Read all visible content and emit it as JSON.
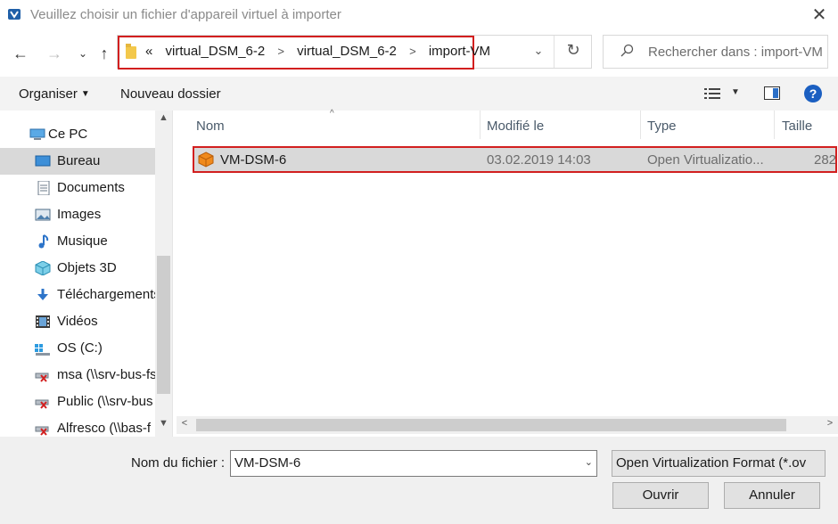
{
  "window": {
    "title": "Veuillez choisir un fichier d'appareil virtuel à importer"
  },
  "address": {
    "overflow": "«",
    "crumbs": [
      "virtual_DSM_6-2",
      "virtual_DSM_6-2",
      "import-VM"
    ]
  },
  "search": {
    "placeholder": "Rechercher dans : import-VM"
  },
  "toolbar": {
    "organize": "Organiser",
    "new_folder": "Nouveau dossier"
  },
  "sidebar": {
    "items": [
      {
        "label": "Ce PC",
        "icon": "computer-icon"
      },
      {
        "label": "Bureau",
        "icon": "desktop-icon",
        "selected": true
      },
      {
        "label": "Documents",
        "icon": "documents-icon"
      },
      {
        "label": "Images",
        "icon": "pictures-icon"
      },
      {
        "label": "Musique",
        "icon": "music-icon"
      },
      {
        "label": "Objets 3D",
        "icon": "3d-objects-icon"
      },
      {
        "label": "Téléchargements",
        "icon": "downloads-icon"
      },
      {
        "label": "Vidéos",
        "icon": "videos-icon"
      },
      {
        "label": "OS (C:)",
        "icon": "drive-icon"
      },
      {
        "label": "msa (\\\\srv-bus-fs",
        "icon": "network-drive-disconnected-icon"
      },
      {
        "label": "Public (\\\\srv-bus",
        "icon": "network-drive-disconnected-icon"
      },
      {
        "label": "Alfresco (\\\\bas-f",
        "icon": "network-drive-disconnected-icon"
      }
    ]
  },
  "filelist": {
    "columns": [
      "Nom",
      "Modifié le",
      "Type",
      "Taille"
    ],
    "rows": [
      {
        "name": "VM-DSM-6",
        "modified": "03.02.2019 14:03",
        "type": "Open Virtualizatio...",
        "size": "282"
      }
    ]
  },
  "footer": {
    "filename_label": "Nom du fichier :",
    "filename_value": "VM-DSM-6",
    "filetype_value": "Open Virtualization Format (*.ov",
    "open_label": "Ouvrir",
    "cancel_label": "Annuler"
  },
  "colors": {
    "highlight": "#d21f1f",
    "selected_bg": "#d9d9d9",
    "accent": "#1b5fc1"
  }
}
